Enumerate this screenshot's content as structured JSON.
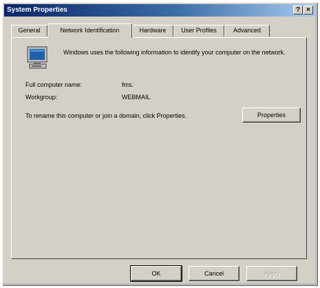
{
  "window": {
    "title": "System Properties",
    "help_label": "?",
    "close_label": "×"
  },
  "tabs": [
    {
      "label": "General"
    },
    {
      "label": "Network Identification"
    },
    {
      "label": "Hardware"
    },
    {
      "label": "User Profiles"
    },
    {
      "label": "Advanced"
    }
  ],
  "active_tab": "Network Identification",
  "panel": {
    "intro": "Windows uses the following information to identify your computer on the network.",
    "full_name_label": "Full computer name:",
    "full_name_value": "fms.",
    "workgroup_label": "Workgroup:",
    "workgroup_value": "WEBMAIL",
    "rename_text": "To rename this computer or join a domain, click Properties.",
    "properties_button": "Properties"
  },
  "footer": {
    "ok": "OK",
    "cancel": "Cancel",
    "apply": "Apply"
  },
  "icon": "computer-monitor-icon"
}
